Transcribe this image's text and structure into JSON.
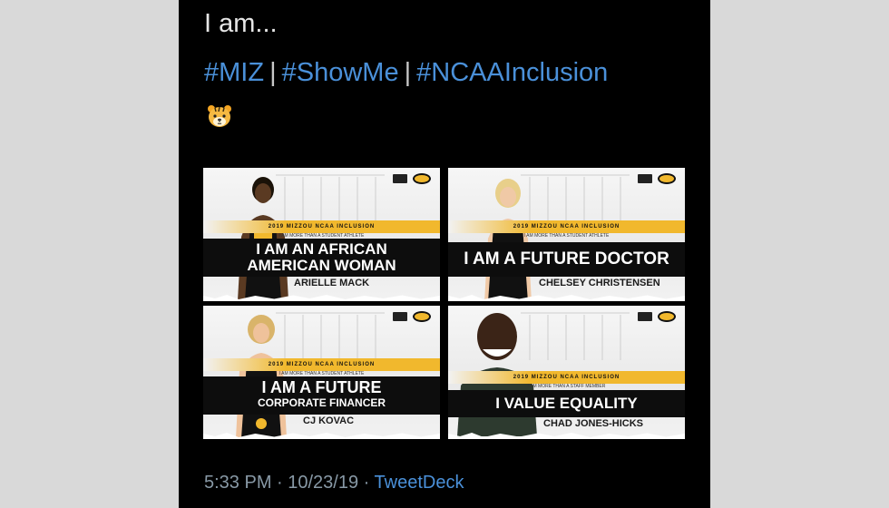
{
  "tweet": {
    "text": "I am...",
    "hashtags": [
      "#MIZ",
      "#ShowMe",
      "#NCAAInclusion"
    ],
    "separator": "|",
    "emoji": "tiger-face-icon",
    "timestamp": "5:33 PM · 10/23/19 · ",
    "source": "TweetDeck"
  },
  "cards": [
    {
      "statement_line1": "I AM AN AFRICAN",
      "statement_line2": "AMERICAN WOMAN",
      "name": "ARIELLE MACK",
      "header": "2019 MIZZOU NCAA INCLUSION",
      "subheader": "I AM MORE THAN A STUDENT ATHLETE"
    },
    {
      "statement_line1": "I AM A FUTURE DOCTOR",
      "statement_line2": "",
      "name": "CHELSEY CHRISTENSEN",
      "header": "2019 MIZZOU NCAA INCLUSION",
      "subheader": "I AM MORE THAN A STUDENT ATHLETE"
    },
    {
      "statement_line1": "I AM A FUTURE",
      "statement_line2": "CORPORATE FINANCER",
      "name": "CJ KOVAC",
      "header": "2019 MIZZOU NCAA INCLUSION",
      "subheader": "I AM MORE THAN A STUDENT ATHLETE"
    },
    {
      "statement_line1": "I VALUE EQUALITY",
      "statement_line2": "",
      "name": "CHAD JONES-HICKS",
      "header": "2019 MIZZOU NCAA INCLUSION",
      "subheader": "I AM MORE THAN A STAFF MEMBER"
    }
  ],
  "colors": {
    "background": "#000000",
    "link": "#4a90d9",
    "gold": "#f1b82d",
    "meta": "#8899a6"
  }
}
